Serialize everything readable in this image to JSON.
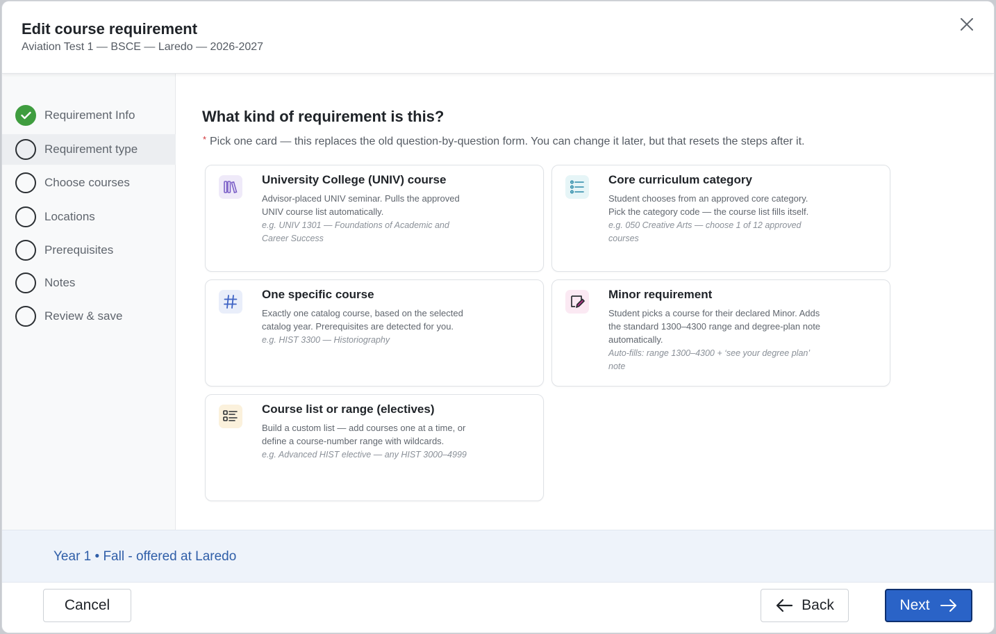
{
  "dialog": {
    "title": "Edit course requirement",
    "subtitle": "Aviation Test 1 — BSCE — Laredo — 2026-2027"
  },
  "steps": [
    {
      "label": "Requirement Info",
      "status": "complete"
    },
    {
      "label": "Requirement type",
      "status": "current"
    },
    {
      "label": "Choose courses",
      "status": "pending"
    },
    {
      "label": "Locations",
      "status": "pending"
    },
    {
      "label": "Prerequisites",
      "status": "pending"
    },
    {
      "label": "Notes",
      "status": "pending"
    },
    {
      "label": "Review & save",
      "status": "pending"
    }
  ],
  "main": {
    "question": "What kind of requirement is this?",
    "required_marker": "*",
    "hint": "Pick one card — this replaces the old question-by-question form. You can change it later, but that resets the steps after it.",
    "cards": [
      {
        "icon": "library-books-icon",
        "icon_color": "#7b5fc7",
        "icon_bg": "#efeaf9",
        "title": "University College (UNIV) course",
        "description": "Advisor-placed UNIV seminar. Pulls the approved UNIV course list automatically.",
        "example": "e.g. UNIV 1301 — Foundations of Academic and Career Success"
      },
      {
        "icon": "checklist-icon",
        "icon_color": "#2a8aa8",
        "icon_bg": "#e6f5f7",
        "title": "Core curriculum category",
        "description": "Student chooses from an approved core category. Pick the category code — the course list fills itself.",
        "example": "e.g. 050 Creative Arts — choose 1 of 12 approved courses"
      },
      {
        "icon": "hash-icon",
        "icon_color": "#3d62c4",
        "icon_bg": "#e9eefa",
        "title": "One specific course",
        "description": "Exactly one catalog course, based on the selected catalog year. Prerequisites are detected for you.",
        "example": "e.g. HIST 3300 — Historiography"
      },
      {
        "icon": "note-edit-icon",
        "icon_color": "#b8338a",
        "icon_bg": "#fbe9f3",
        "title": "Minor requirement",
        "description": "Student picks a course for their declared Minor. Adds the standard 1300–4300 range and degree-plan note automatically.",
        "example": "Auto-fills: range 1300–4300 + ‘see your degree plan’ note"
      },
      {
        "icon": "list-icon",
        "icon_color": "#b07a1c",
        "icon_bg": "#fbf1dc",
        "title": "Course list or range (electives)",
        "description": "Build a custom list — add courses one at a time, or define a course-number range with wildcards.",
        "example": "e.g. Advanced HIST elective — any HIST 3000–4999"
      }
    ]
  },
  "footer": {
    "context": "Year 1 • Fall - offered at Laredo"
  },
  "actions": {
    "cancel": "Cancel",
    "back": "Back",
    "next": "Next"
  },
  "colors": {
    "accent": "#2a63c7",
    "complete": "#3f9d3f",
    "footer_text": "#2f5ea8"
  }
}
